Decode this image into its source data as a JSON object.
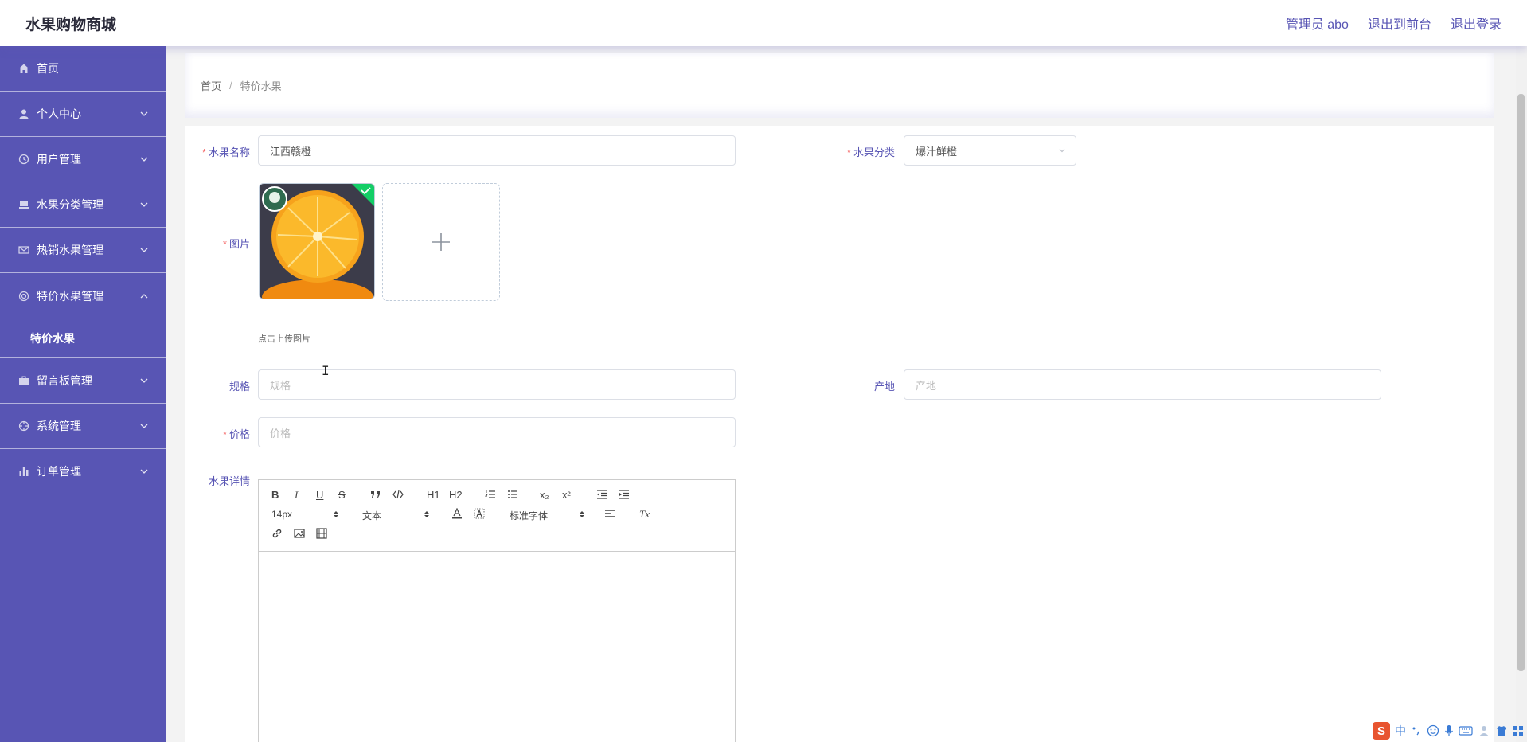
{
  "app": {
    "title": "水果购物商城"
  },
  "header": {
    "links": [
      "管理员 abo",
      "退出到前台",
      "退出登录"
    ]
  },
  "sidebar": {
    "items": [
      {
        "label": "首页",
        "icon": "home-icon"
      },
      {
        "label": "个人中心",
        "icon": "user-icon"
      },
      {
        "label": "用户管理",
        "icon": "clock-icon"
      },
      {
        "label": "水果分类管理",
        "icon": "box-icon"
      },
      {
        "label": "热销水果管理",
        "icon": "mail-icon"
      },
      {
        "label": "特价水果管理",
        "icon": "lifebuoy-icon",
        "expanded": true
      },
      {
        "label": "留言板管理",
        "icon": "briefcase-icon"
      },
      {
        "label": "系统管理",
        "icon": "aperture-icon"
      },
      {
        "label": "订单管理",
        "icon": "bar-chart-icon"
      }
    ],
    "submenu": [
      "特价水果"
    ]
  },
  "breadcrumb": {
    "home": "首页",
    "separator": "/",
    "current": "特价水果"
  },
  "form": {
    "name": {
      "label": "水果名称",
      "value": "江西赣橙",
      "required": true
    },
    "category": {
      "label": "水果分类",
      "value": "爆汁鲜橙",
      "required": true
    },
    "image": {
      "label": "图片",
      "hint": "点击上传图片",
      "required": true
    },
    "spec": {
      "label": "规格",
      "placeholder": "规格"
    },
    "origin": {
      "label": "产地",
      "placeholder": "产地"
    },
    "price": {
      "label": "价格",
      "placeholder": "价格",
      "required": true
    },
    "detail": {
      "label": "水果详情"
    },
    "required_mark": "*"
  },
  "editor": {
    "buttons": {
      "bold": "B",
      "italic": "I",
      "underline": "U",
      "strike": "S",
      "h1": "H1",
      "h2": "H2",
      "sub": "x₂",
      "sup": "x²",
      "clean": "Tx"
    },
    "pickers": {
      "size": "14px",
      "header": "文本",
      "font": "标准字体"
    }
  },
  "ime": {
    "lang": "中"
  },
  "colors": {
    "accent": "#5855b4",
    "required": "#f56c6c",
    "success": "#13ce66"
  }
}
